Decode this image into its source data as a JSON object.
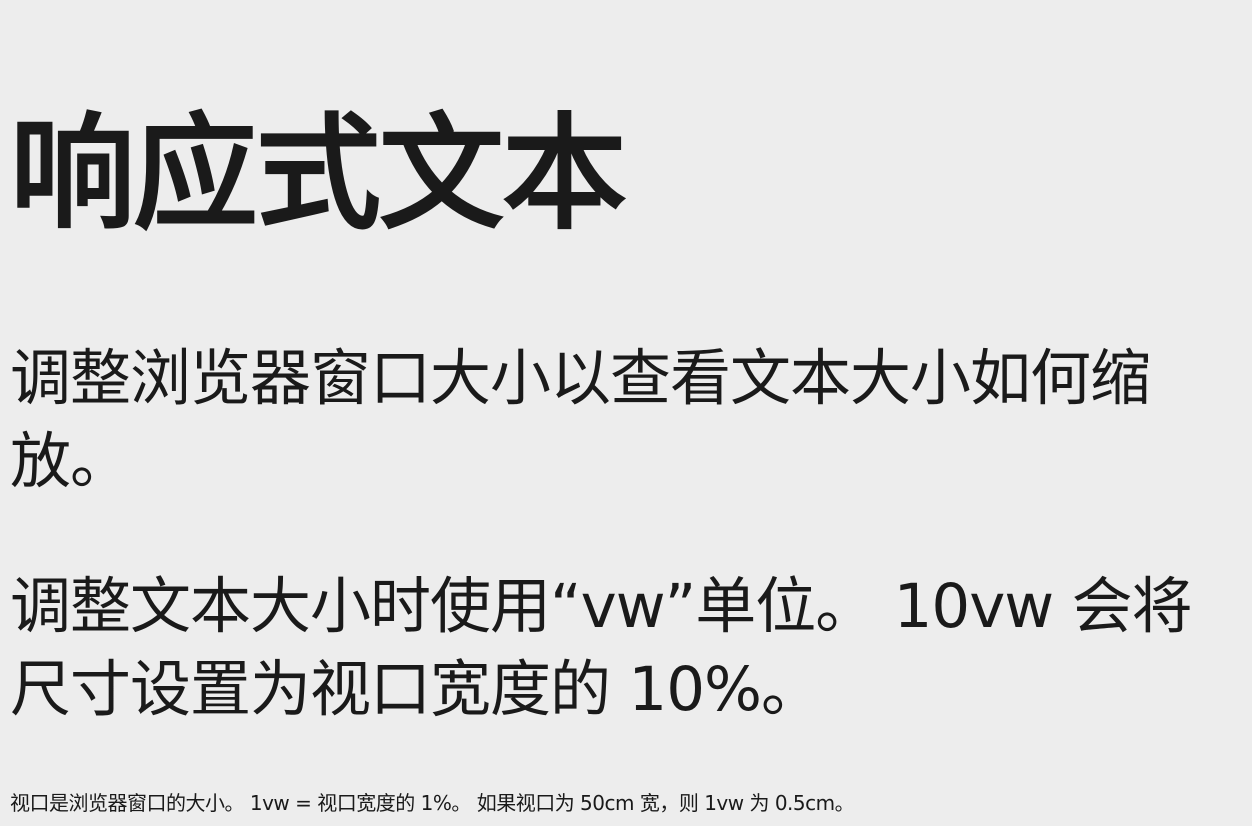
{
  "heading": {
    "title": "响应式文本"
  },
  "content": {
    "paragraph_1": "调整浏览器窗口大小以查看文本大小如何缩放。",
    "paragraph_2": "调整文本大小时使用“vw”单位。 10vw 会将尺寸设置为视口宽度的 10%。",
    "footnote": "视口是浏览器窗口的大小。 1vw = 视口宽度的 1%。 如果视口为 50cm 宽，则 1vw 为 0.5cm。"
  },
  "colors": {
    "background": "#ededed",
    "text": "#1a1a1a"
  }
}
